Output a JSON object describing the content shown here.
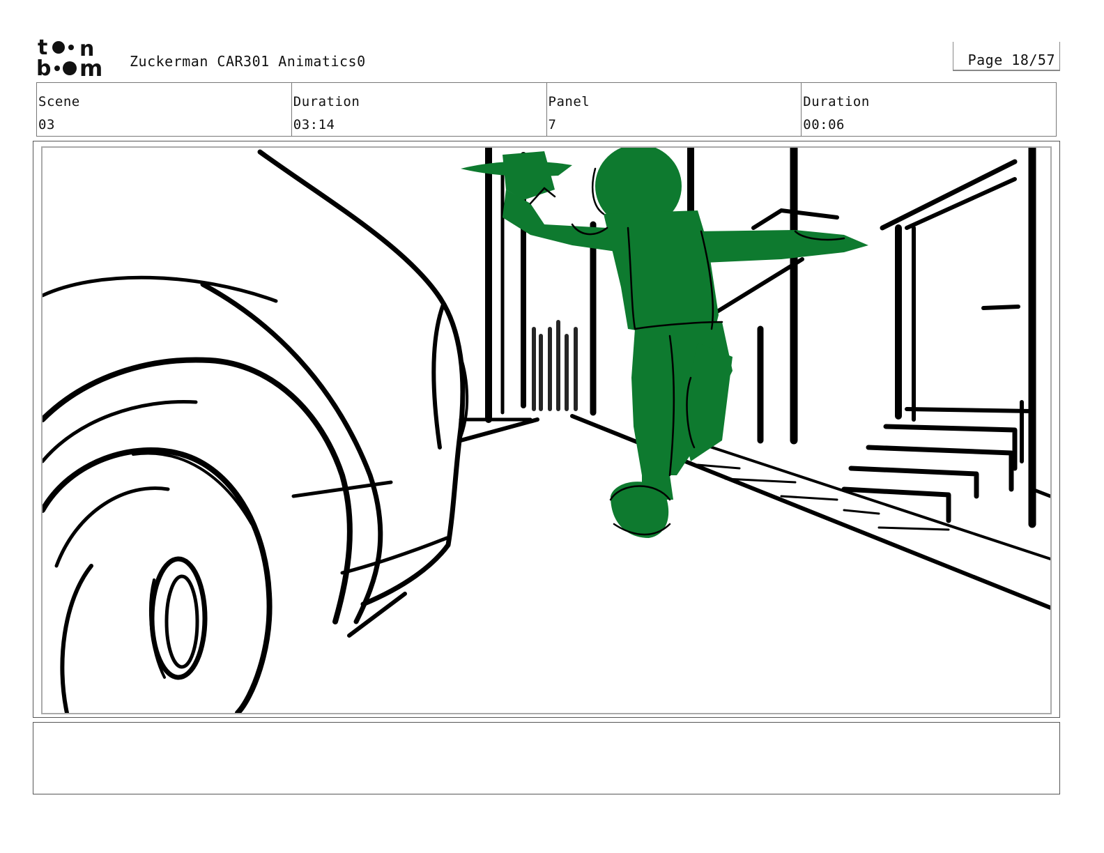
{
  "header": {
    "logo_text": "toon boom",
    "title": "Zuckerman CAR301 Animatics0",
    "page_label": "Page 18/57"
  },
  "info": {
    "scene_label": "Scene",
    "scene_value": "03",
    "duration_label": "Duration",
    "duration_value": "03:14",
    "panel_label": "Panel",
    "panel_value": "7",
    "panel_duration_label": "Duration",
    "panel_duration_value": "00:06"
  },
  "colors": {
    "character_green": "#0e7a2f",
    "ink": "#000000",
    "frame_gray": "#aaaaaa"
  },
  "notes": {
    "text": ""
  }
}
